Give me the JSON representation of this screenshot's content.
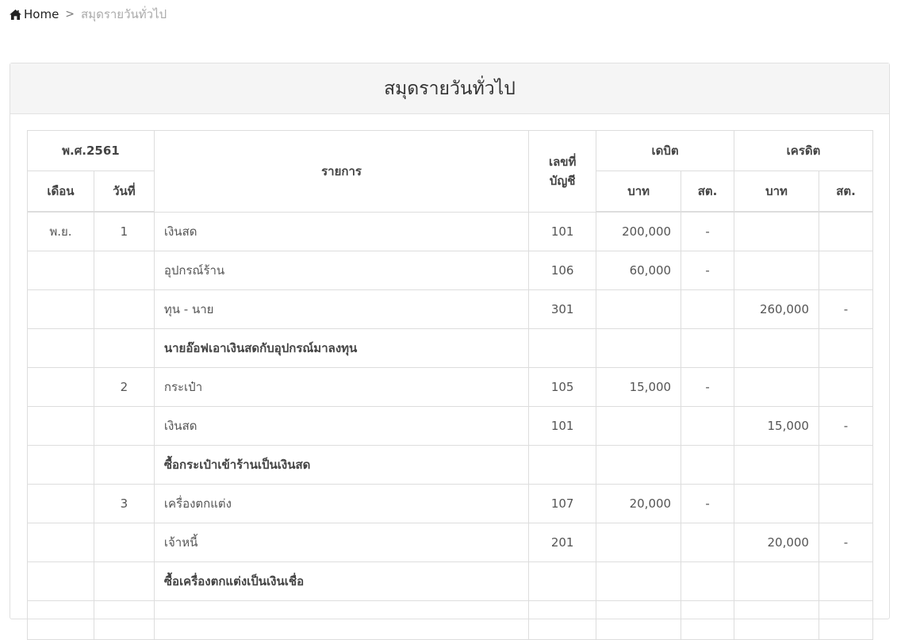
{
  "breadcrumb": {
    "home": "Home",
    "separator": ">",
    "current": "สมุดรายวันทั่วไป"
  },
  "panel": {
    "title": "สมุดรายวันทั่วไป"
  },
  "table": {
    "headers": {
      "year": "พ.ศ.2561",
      "month": "เดือน",
      "day": "วันที่",
      "item": "รายการ",
      "account_no_line1": "เลขที่",
      "account_no_line2": "บัญชี",
      "debit": "เดบิต",
      "credit": "เครดิต",
      "baht": "บาท",
      "satang": "สต."
    },
    "rows": [
      {
        "month": "พ.ย.",
        "day": "1",
        "item": "เงินสด",
        "ref": "101",
        "debit": "200,000",
        "debit_st": "-",
        "credit": "",
        "credit_st": ""
      },
      {
        "month": "",
        "day": "",
        "item": "อุปกรณ์ร้าน",
        "ref": "106",
        "debit": "60,000",
        "debit_st": "-",
        "credit": "",
        "credit_st": ""
      },
      {
        "month": "",
        "day": "",
        "item": "ทุน - นาย",
        "ref": "301",
        "debit": "",
        "debit_st": "",
        "credit": "260,000",
        "credit_st": "-"
      },
      {
        "month": "",
        "day": "",
        "item": "นายอ๊อฟเอาเงินสดกับอุปกรณ์มาลงทุน",
        "ref": "",
        "debit": "",
        "debit_st": "",
        "credit": "",
        "credit_st": ""
      },
      {
        "month": "",
        "day": "2",
        "item": "กระเป๋า",
        "ref": "105",
        "debit": "15,000",
        "debit_st": "-",
        "credit": "",
        "credit_st": ""
      },
      {
        "month": "",
        "day": "",
        "item": "เงินสด",
        "ref": "101",
        "debit": "",
        "debit_st": "",
        "credit": "15,000",
        "credit_st": "-"
      },
      {
        "month": "",
        "day": "",
        "item": "ซื้อกระเป๋าเข้าร้านเป็นเงินสด",
        "ref": "",
        "debit": "",
        "debit_st": "",
        "credit": "",
        "credit_st": ""
      },
      {
        "month": "",
        "day": "3",
        "item": "เครื่องตกแต่ง",
        "ref": "107",
        "debit": "20,000",
        "debit_st": "-",
        "credit": "",
        "credit_st": ""
      },
      {
        "month": "",
        "day": "",
        "item": "เจ้าหนี้",
        "ref": "201",
        "debit": "",
        "debit_st": "",
        "credit": "20,000",
        "credit_st": "-"
      },
      {
        "month": "",
        "day": "",
        "item": "ซื้อเครื่องตกแต่งเป็นเงินเชื่อ",
        "ref": "",
        "debit": "",
        "debit_st": "",
        "credit": "",
        "credit_st": ""
      },
      {
        "month": "",
        "day": "",
        "item": "",
        "ref": "",
        "debit": "",
        "debit_st": "",
        "credit": "",
        "credit_st": ""
      }
    ]
  }
}
